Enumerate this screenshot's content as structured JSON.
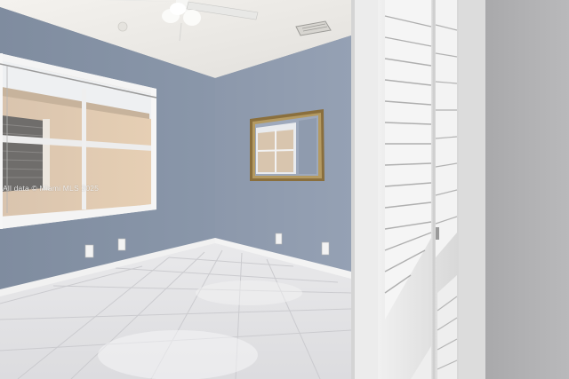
{
  "photo": {
    "watermark": "All data © Miami MLS 2025",
    "colors": {
      "wall_left": "#8491a4",
      "wall_back": "#909cb0",
      "ceiling": "#eceae6",
      "floor": "#e4e4e6",
      "door": "#e8e8e8",
      "baseboard": "#f2f2f2",
      "mirror_frame": "#8a6f3d"
    }
  }
}
